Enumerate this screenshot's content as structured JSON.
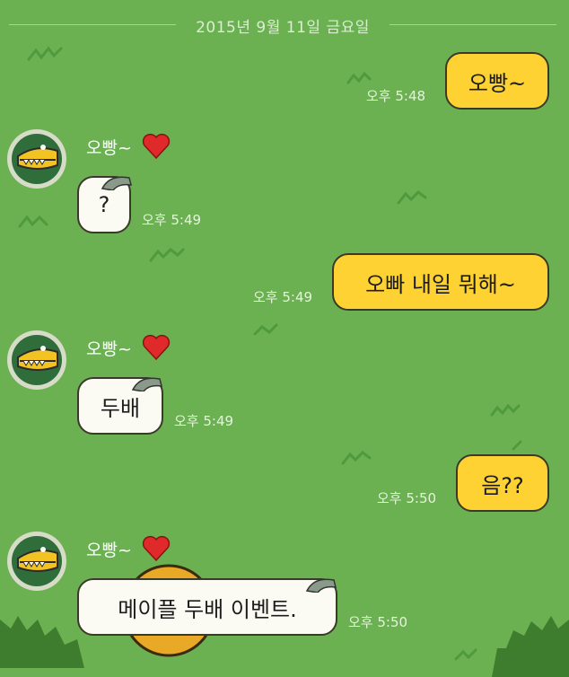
{
  "date_divider": "2015년 9월 11일 금요일",
  "colors": {
    "background": "#6bb152",
    "my_bubble": "#ffd233",
    "their_bubble": "#fbfbf3",
    "time_text": "#e6f3dd"
  },
  "messages": [
    {
      "sender": "me",
      "text": "오빵~",
      "time": "오후 5:48"
    },
    {
      "sender": "other",
      "name": "오빵~",
      "text": "?",
      "time": "오후 5:49"
    },
    {
      "sender": "me",
      "text": "오빠 내일 뭐해~",
      "time": "오후 5:49"
    },
    {
      "sender": "other",
      "name": "오빵~",
      "text": "두배",
      "time": "오후 5:49"
    },
    {
      "sender": "me",
      "text": "음??",
      "time": "오후 5:50"
    },
    {
      "sender": "other",
      "name": "오빵~",
      "text": "메이플 두배 이벤트.",
      "time": "오후 5:50"
    }
  ],
  "icons": {
    "heart": "heart-icon",
    "avatar": "crocodile-avatar"
  }
}
